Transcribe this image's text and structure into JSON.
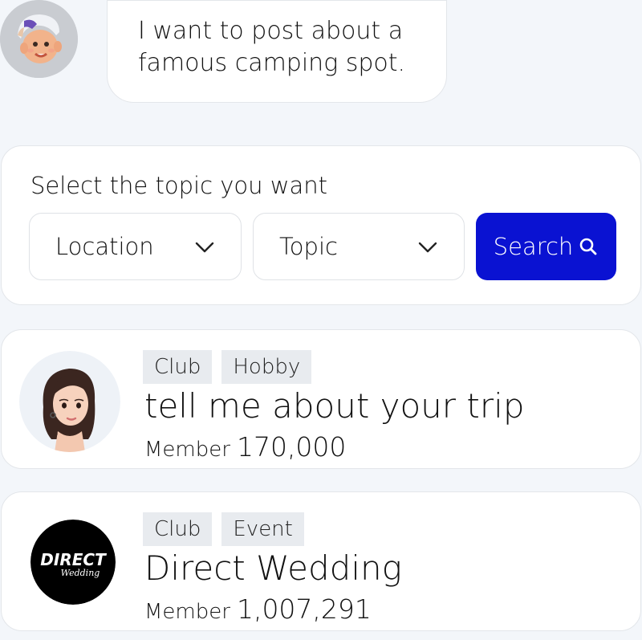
{
  "chat": {
    "message": "I want to post about a famous camping spot."
  },
  "topic_selector": {
    "title": "Select the topic you want",
    "location_label": "Location",
    "topic_label": "Topic",
    "search_label": "Search"
  },
  "clubs": [
    {
      "tags": [
        "Club",
        "Hobby"
      ],
      "name": "tell me about your trip",
      "members_label": "Member",
      "members_count": "170,000"
    },
    {
      "tags": [
        "Club",
        "Event"
      ],
      "name": "Direct Wedding",
      "members_label": "Member",
      "members_count": "1,007,291",
      "logo_text": "DIRECT",
      "logo_script": "Wedding"
    }
  ],
  "colors": {
    "accent": "#0a12d2",
    "background": "#f3f6fa",
    "card": "#ffffff",
    "tag_bg": "#e8ebef"
  },
  "icons": {
    "user_avatar": "boy-avatar-icon",
    "dropdown": "chevron-down-icon",
    "search": "search-icon",
    "club1_avatar": "woman-avatar-icon",
    "club2_logo": "direct-wedding-logo"
  }
}
